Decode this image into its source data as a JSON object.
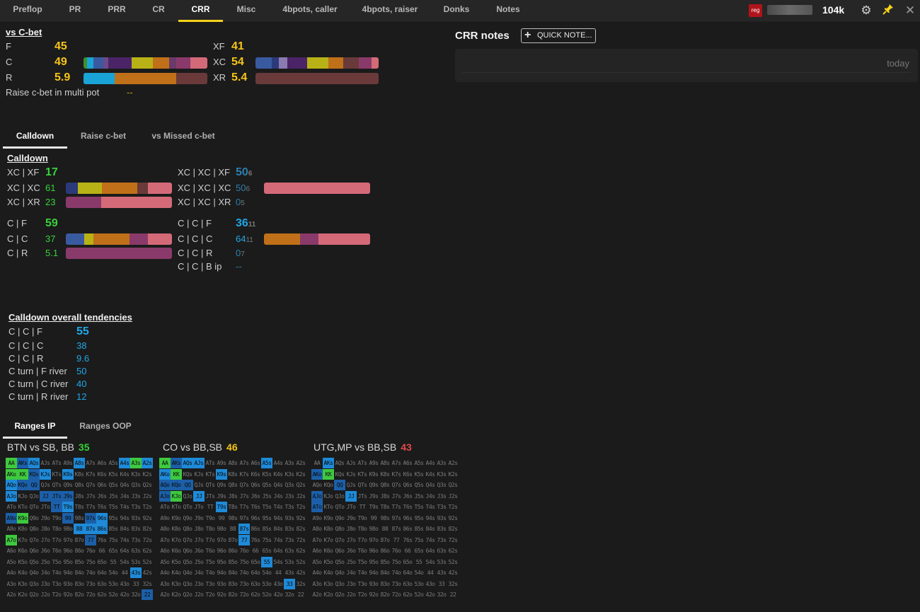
{
  "nav": {
    "tabs": [
      "Preflop",
      "PR",
      "PRR",
      "CR",
      "CRR",
      "Misc",
      "4bpots, caller",
      "4bpots, raiser",
      "Donks",
      "Notes"
    ],
    "active": "CRR",
    "badge": "reg",
    "stack": "104k"
  },
  "vs_cbet": {
    "title": "vs C-bet",
    "rows_left": [
      {
        "label": "F",
        "value": "45"
      },
      {
        "label": "C",
        "value": "49"
      },
      {
        "label": "R",
        "value": "5.9"
      }
    ],
    "rows_right": [
      {
        "label": "XF",
        "value": "41"
      },
      {
        "label": "XC",
        "value": "54"
      },
      {
        "label": "XR",
        "value": "5.4"
      }
    ],
    "multi_label": "Raise c-bet in multi pot",
    "multi_value": "--",
    "bar_c": [
      [
        "#3f8f2b",
        3
      ],
      [
        "#1aa3d6",
        5
      ],
      [
        "#3a5aa0",
        8
      ],
      [
        "#6b4a8a",
        4
      ],
      [
        "#4a2466",
        19
      ],
      [
        "#b9b216",
        17
      ],
      [
        "#c07018",
        13
      ],
      [
        "#6a3a6a",
        6
      ],
      [
        "#8a3a6a",
        11
      ],
      [
        "#d46a78",
        14
      ]
    ],
    "bar_r": [
      [
        "#1aa3d6",
        25
      ],
      [
        "#c07018",
        50
      ],
      [
        "#6a3a3a",
        25
      ]
    ],
    "bar_xc": [
      [
        "#3a5aa0",
        13
      ],
      [
        "#2a3a7a",
        6
      ],
      [
        "#8a7ab0",
        7
      ],
      [
        "#4a2466",
        16
      ],
      [
        "#b9b216",
        17
      ],
      [
        "#c07018",
        12
      ],
      [
        "#6a3a3a",
        13
      ],
      [
        "#8a3a6a",
        10
      ],
      [
        "#d46a78",
        6
      ]
    ],
    "bar_xr": [
      [
        "#6a3a3a",
        100
      ]
    ]
  },
  "subtabs1": [
    "Calldown",
    "Raise c-bet",
    "vs Missed c-bet"
  ],
  "calldown": {
    "title": "Calldown",
    "left": [
      {
        "label": "XC | XF",
        "value": "17"
      },
      {
        "label": "XC | XC",
        "value": "61"
      },
      {
        "label": "XC | XR",
        "value": "23"
      },
      {
        "label": "C | F",
        "value": "59"
      },
      {
        "label": "C | C",
        "value": "37"
      },
      {
        "label": "C | R",
        "value": "5.1"
      }
    ],
    "right": [
      {
        "label": "XC | XC | XF",
        "value": "50",
        "n": "6"
      },
      {
        "label": "XC | XC | XC",
        "value": "50",
        "n": "6"
      },
      {
        "label": "XC | XC | XR",
        "value": "0",
        "n": "5"
      },
      {
        "label": "C | C | F",
        "value": "36",
        "n": "11"
      },
      {
        "label": "C | C | C",
        "value": "64",
        "n": "11"
      },
      {
        "label": "C | C | R",
        "value": "0",
        "n": "7"
      },
      {
        "label": "C | C | B ip",
        "value": "--",
        "n": ""
      }
    ],
    "bar_xcxc": [
      [
        "#2a3a7a",
        11
      ],
      [
        "#b9b216",
        23
      ],
      [
        "#c07018",
        33
      ],
      [
        "#6a3a3a",
        10
      ],
      [
        "#d46a78",
        23
      ]
    ],
    "bar_xcxr": [
      [
        "#8a3a6a",
        33
      ],
      [
        "#d46a78",
        67
      ]
    ],
    "bar_cc": [
      [
        "#3a5aa0",
        17
      ],
      [
        "#b9b216",
        9
      ],
      [
        "#c07018",
        34
      ],
      [
        "#8a3a6a",
        17
      ],
      [
        "#d46a78",
        23
      ]
    ],
    "bar_cr": [
      [
        "#8a3a6a",
        100
      ]
    ],
    "bar_ccc_right": [
      [
        "#c07018",
        34
      ],
      [
        "#8a3a6a",
        17
      ],
      [
        "#d46a78",
        49
      ]
    ],
    "bar_xcxcxc_right": [
      [
        "#d46a78",
        100
      ]
    ]
  },
  "tendencies": {
    "title": "Calldown overall tendencies",
    "rows": [
      {
        "label": "C | C | F",
        "value": "55"
      },
      {
        "label": "C | C | C",
        "value": "38"
      },
      {
        "label": "C | C | R",
        "value": "9.6"
      },
      {
        "label": "C turn | F river",
        "value": "50"
      },
      {
        "label": "C turn | C river",
        "value": "40"
      },
      {
        "label": "C turn | R river",
        "value": "12"
      }
    ]
  },
  "subtabs2": [
    "Ranges IP",
    "Ranges OOP"
  ],
  "ranges": [
    {
      "title": "BTN vs SB, BB",
      "value": "35",
      "color": "#37d33a"
    },
    {
      "title": "CO vs BB,SB",
      "value": "46",
      "color": "#f5c518"
    },
    {
      "title": "UTG,MP vs BB,SB",
      "value": "43",
      "color": "#e04a4a"
    }
  ],
  "notes": {
    "title": "CRR notes",
    "quick": "QUICK NOTE...",
    "today": "today"
  }
}
